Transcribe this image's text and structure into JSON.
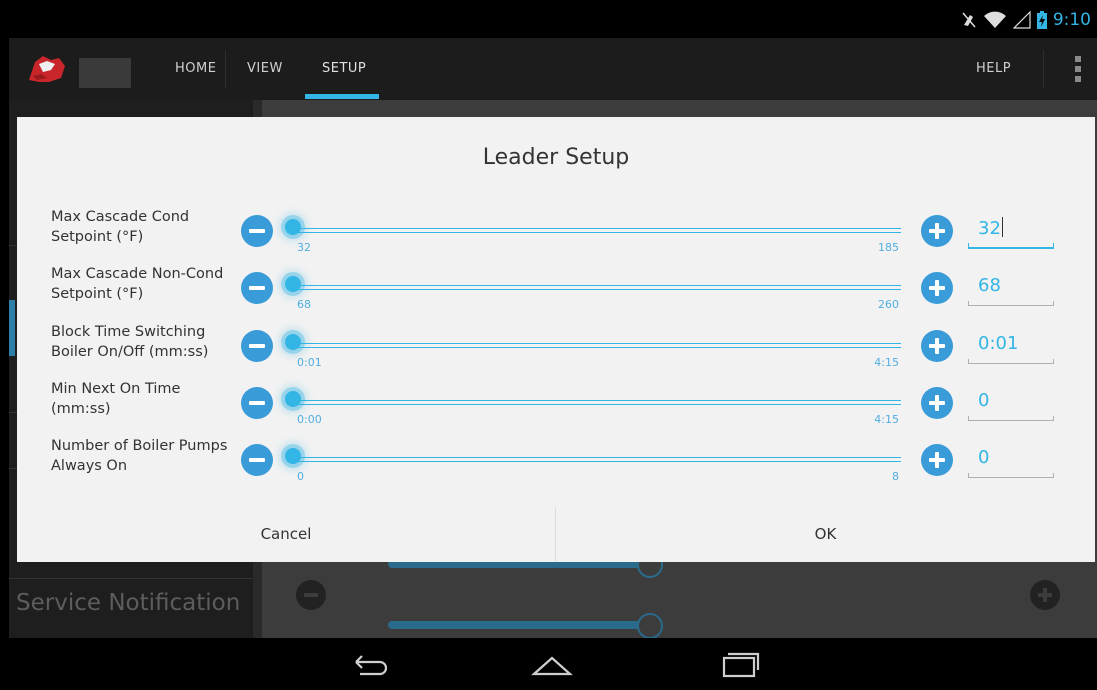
{
  "status": {
    "time": "9:10",
    "icons": [
      "mute-icon",
      "wifi-icon",
      "signal-icon",
      "battery-charging-icon"
    ]
  },
  "actionbar": {
    "tabs": [
      {
        "label": "HOME"
      },
      {
        "label": "VIEW"
      },
      {
        "label": "SETUP",
        "active": true
      },
      {
        "label": "HELP"
      }
    ]
  },
  "background": {
    "sidebar_item": "Service Notification"
  },
  "dialog": {
    "title": "Leader Setup",
    "rows": [
      {
        "label": "Max Cascade Cond Setpoint (°F)",
        "min": "32",
        "max": "185",
        "value": "32",
        "level": 0
      },
      {
        "label": "Max Cascade Non-Cond Setpoint (°F)",
        "min": "68",
        "max": "260",
        "value": "68",
        "level": 0
      },
      {
        "label": "Block Time Switching Boiler On/Off (mm:ss)",
        "min": "0:01",
        "max": "4:15",
        "value": "0:01",
        "level": 0
      },
      {
        "label": "Min Next On Time (mm:ss)",
        "min": "0:00",
        "max": "4:15",
        "value": "0",
        "level": 0
      },
      {
        "label": "Number of Boiler Pumps Always On",
        "min": "0",
        "max": "8",
        "value": "0",
        "level": 0
      }
    ],
    "cancel_label": "Cancel",
    "ok_label": "OK"
  },
  "colors": {
    "accent": "#33b5e5",
    "button_blue": "#3a9bd9",
    "dialog_bg": "#f2f2f2"
  }
}
